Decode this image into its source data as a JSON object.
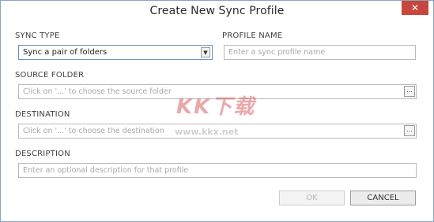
{
  "window": {
    "title": "Create New Sync Profile",
    "close_glyph": "✕"
  },
  "form": {
    "sync_type": {
      "label": "SYNC TYPE",
      "value": "Sync a pair of folders",
      "arrow": "▼"
    },
    "profile_name": {
      "label": "PROFILE NAME",
      "placeholder": "Enter a sync profile name"
    },
    "source_folder": {
      "label": "SOURCE FOLDER",
      "placeholder": "Click on '...' to choose the source folder",
      "browse": "..."
    },
    "destination": {
      "label": "DESTINATION",
      "placeholder": "Click on '...' to choose the destination",
      "browse": "..."
    },
    "description": {
      "label": "DESCRIPTION",
      "placeholder": "Enter an optional description for that profile"
    }
  },
  "buttons": {
    "ok": "OK",
    "cancel": "CANCEL"
  },
  "watermark": {
    "logo": "KK下载",
    "url": "www.kkx.net"
  },
  "colors": {
    "close_button": "#c7463d",
    "select_border": "#6a8fc6"
  }
}
